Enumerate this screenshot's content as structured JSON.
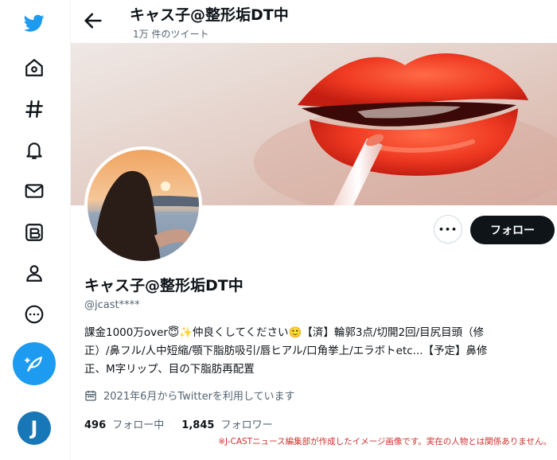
{
  "header": {
    "title": "キャス子@整形垢DT中",
    "tweet_count": "1万 件のツイート"
  },
  "profile": {
    "name": "キャス子@整形垢DT中",
    "handle": "@jcast****",
    "bio_lines": [
      "課金1000万over😇✨仲良くしてください🙂【済】輪郭3点/切開2回/目尻目頭（修",
      "正）/鼻フル/人中短縮/顎下脂肪吸引/唇ヒアル/口角挙上/エラボトetc...【予定】鼻修",
      "正、M字リップ、目の下脂肪再配置"
    ],
    "joined": "2021年6月からTwitterを利用しています",
    "following_count": "496",
    "following_label": "フォロー中",
    "followers_count": "1,845",
    "followers_label": "フォロワー"
  },
  "actions": {
    "more_label": "•••",
    "follow_label": "フォロー"
  },
  "sidebar": {
    "items": [
      {
        "name": "twitter-logo-icon"
      },
      {
        "name": "home-icon"
      },
      {
        "name": "explore-hashtag-icon"
      },
      {
        "name": "notifications-bell-icon"
      },
      {
        "name": "messages-envelope-icon"
      },
      {
        "name": "lists-icon"
      },
      {
        "name": "profile-icon"
      },
      {
        "name": "more-circle-icon"
      }
    ],
    "compose_icon": "compose-feather-icon",
    "account_initial": "J"
  },
  "disclaimer": "※J-CASTニュース編集部が作成したイメージ画像です。実在の人物とは関係ありません。",
  "colors": {
    "accent": "#1d9bf0",
    "text_primary": "#0f1419",
    "text_secondary": "#536471",
    "follow_button_bg": "#0f1419",
    "disclaimer_red": "#d0312d"
  }
}
